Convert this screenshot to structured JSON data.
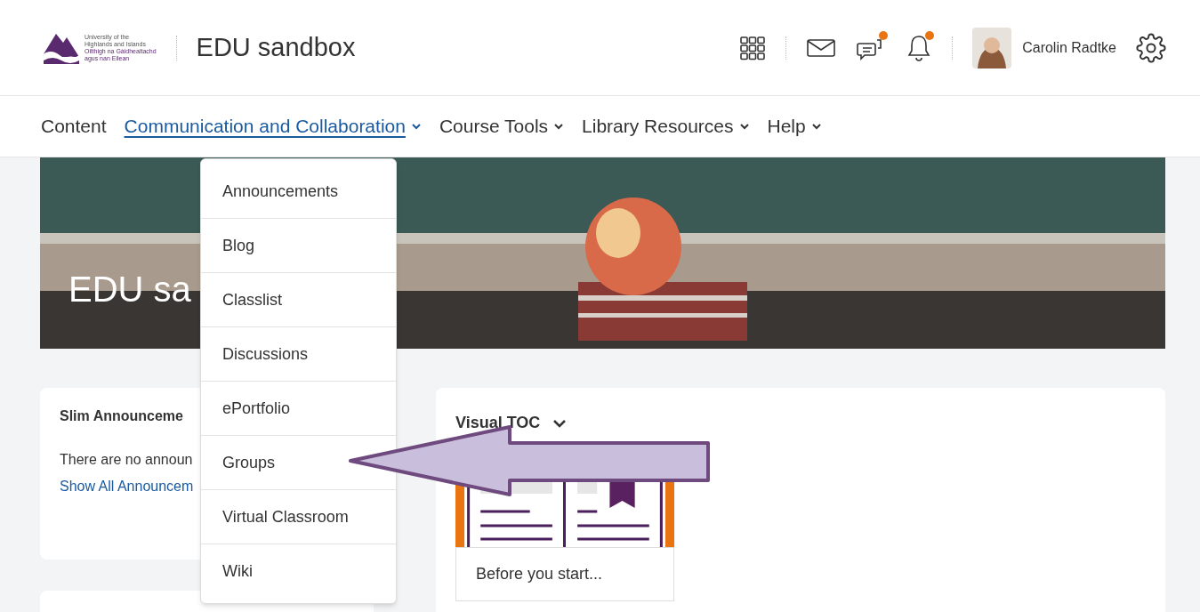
{
  "logo": {
    "lines": [
      "University of the",
      "Highlands and Islands",
      "Oilthigh na Gàidhealtachd",
      "agus nan Eilean"
    ]
  },
  "course_title": "EDU sandbox",
  "user": {
    "name": "Carolin Radtke"
  },
  "header_icons": [
    {
      "kind": "grid",
      "badge": false
    },
    {
      "kind": "mail",
      "badge": false
    },
    {
      "kind": "chat",
      "badge": true
    },
    {
      "kind": "bell",
      "badge": true
    }
  ],
  "nav": [
    {
      "label": "Content",
      "menu": false,
      "selected": false
    },
    {
      "label": "Communication and Collaboration",
      "menu": true,
      "selected": true
    },
    {
      "label": "Course Tools",
      "menu": true,
      "selected": false
    },
    {
      "label": "Library Resources",
      "menu": true,
      "selected": false
    },
    {
      "label": "Help",
      "menu": true,
      "selected": false
    }
  ],
  "banner": {
    "title": "EDU sa"
  },
  "dropdown": [
    "Announcements",
    "Blog",
    "Classlist",
    "Discussions",
    "ePortfolio",
    "Groups",
    "Virtual Classroom",
    "Wiki"
  ],
  "announcements": {
    "title": "Slim Announceme",
    "message": "There are no announ",
    "link": "Show All Announcem"
  },
  "visual_toc": {
    "title": "Visual TOC",
    "tiles": [
      {
        "caption": "Before you start..."
      }
    ]
  }
}
